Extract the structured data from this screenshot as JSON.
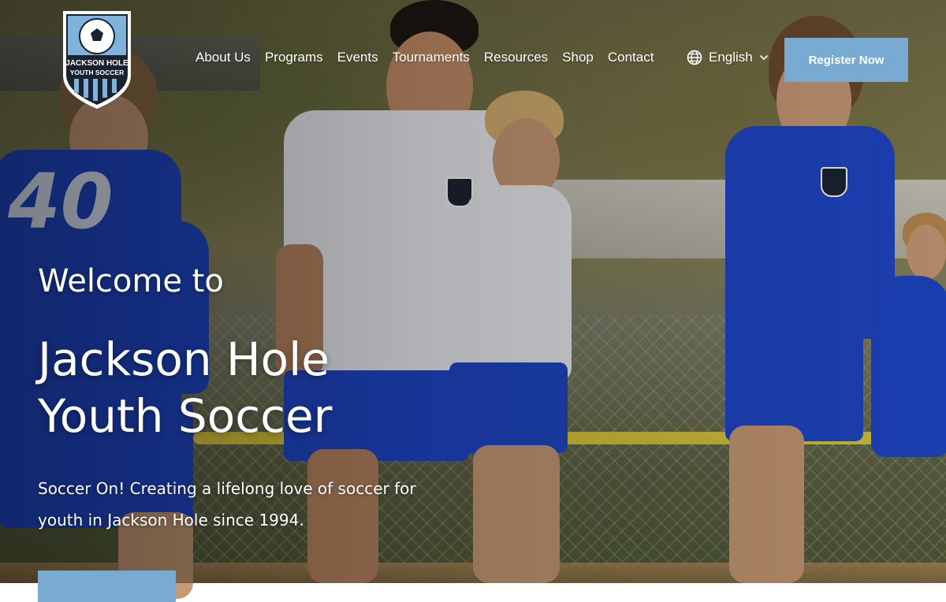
{
  "brand": {
    "logo_line1": "JACKSON HOLE",
    "logo_line2": "YOUTH SOCCER"
  },
  "nav": {
    "items": [
      "About Us",
      "Programs",
      "Events",
      "Tournaments",
      "Resources",
      "Shop",
      "Contact"
    ],
    "language": "English",
    "register_label": "Register Now"
  },
  "hero": {
    "welcome": "Welcome to",
    "title_line1": "Jackson Hole",
    "title_line2": "Youth Soccer",
    "tagline": "Soccer On! Creating a lifelong love of soccer for youth in Jackson Hole since 1994.",
    "jersey_number": "40"
  },
  "colors": {
    "accent": "#78aad2",
    "jersey_blue": "#1f47c8",
    "crest_dark": "#1c2433"
  },
  "icons": {
    "language": "globe-icon",
    "language_toggle": "chevron-down-icon"
  }
}
